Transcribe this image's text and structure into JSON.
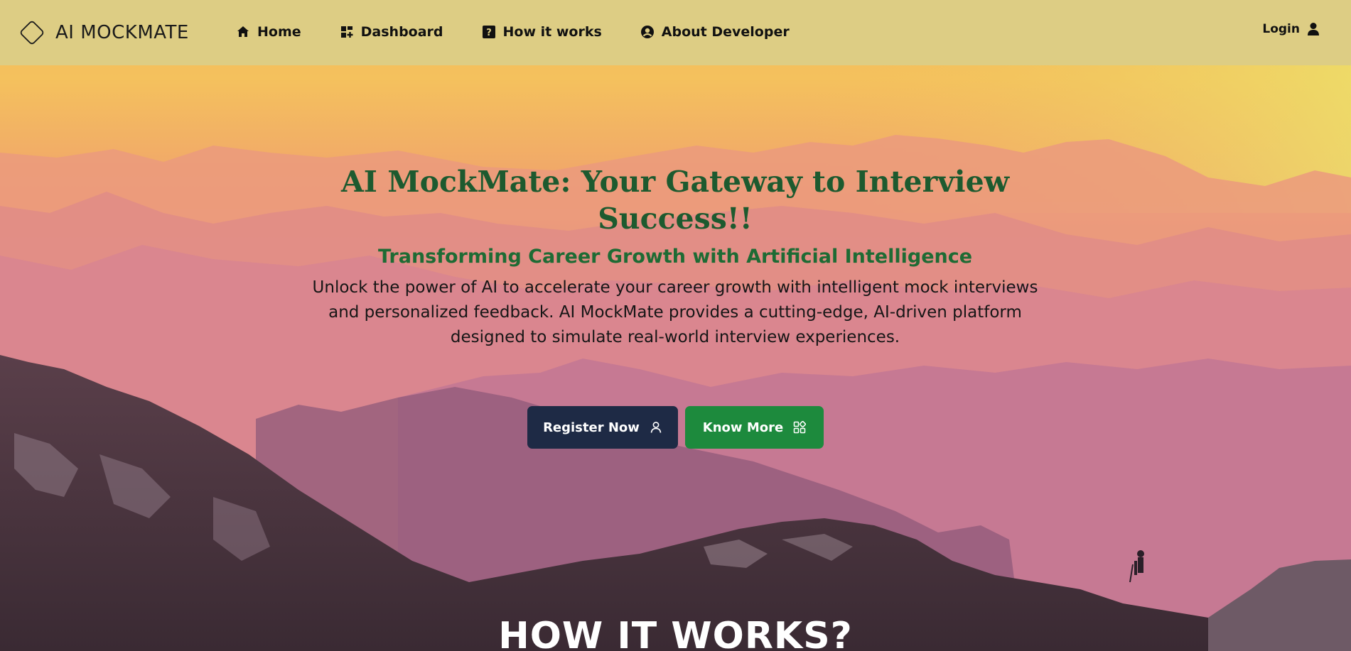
{
  "brand": {
    "name": "AI MOCKMATE",
    "logo_icon": "diamond-logo-icon"
  },
  "nav": {
    "items": [
      {
        "label": "Home",
        "icon": "home-icon"
      },
      {
        "label": "Dashboard",
        "icon": "dashboard-grid-icon"
      },
      {
        "label": "How it works",
        "icon": "question-icon"
      },
      {
        "label": "About Developer",
        "icon": "user-circle-icon"
      }
    ],
    "login": {
      "label": "Login",
      "icon": "user-icon"
    }
  },
  "hero": {
    "title": "AI MockMate: Your Gateway to Interview Success!!",
    "subtitle": "Transforming Career Growth with Artificial Intelligence",
    "description": "Unlock the power of AI to accelerate your career growth with intelligent mock interviews and personalized feedback. AI MockMate provides a cutting-edge, AI-driven platform designed to simulate real-world interview experiences.",
    "register_button": {
      "label": "Register Now",
      "icon": "user-outline-icon"
    },
    "know_more_button": {
      "label": "Know More",
      "icon": "apps-icon"
    }
  },
  "section": {
    "heading": "HOW IT WORKS?"
  },
  "colors": {
    "navbar_bg": "#ddcd84",
    "title_green": "#1d5a2f",
    "register_bg": "#1e2a45",
    "know_more_bg": "#1d8a3d"
  }
}
